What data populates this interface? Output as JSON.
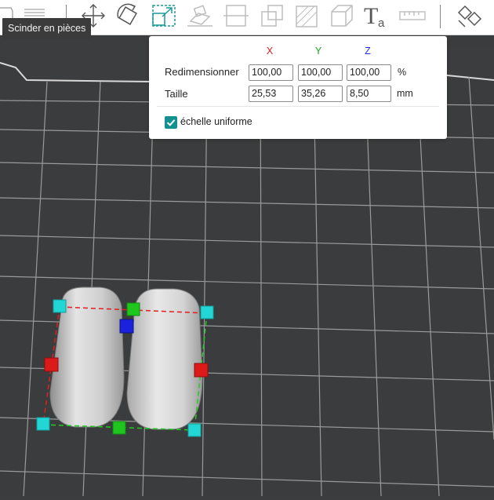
{
  "tooltip": {
    "text": "Scinder en pièces"
  },
  "toolbar": {
    "icons": [
      "cube-partial-icon",
      "layers-icon",
      "move-icon",
      "rotate-icon",
      "scale-icon",
      "place-on-face-icon",
      "cut-icon",
      "mesh-boolean-icon",
      "support-painting-icon",
      "seam-painting-icon",
      "text-icon",
      "measure-icon",
      "split-to-objects-icon"
    ]
  },
  "scale_panel": {
    "axis_x": "X",
    "axis_y": "Y",
    "axis_z": "Z",
    "axis_colors": {
      "x": "#e02020",
      "y": "#1aa31a",
      "z": "#2030d8"
    },
    "resize_label": "Redimensionner",
    "resize_values": [
      "100,00",
      "100,00",
      "100,00"
    ],
    "resize_unit": "%",
    "size_label": "Taille",
    "size_values": [
      "25,53",
      "35,26",
      "8,50"
    ],
    "size_unit": "mm",
    "uniform_scale_label": "échelle uniforme",
    "uniform_scale_checked": true
  },
  "colors": {
    "accent": "#139191",
    "bed": "#3c3d3e",
    "grid": "#9a9a9a"
  }
}
